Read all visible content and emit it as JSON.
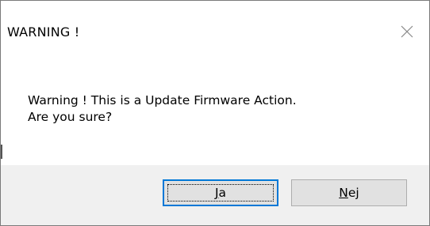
{
  "window": {
    "title": "WARNING !",
    "close_icon": "close-icon"
  },
  "message": {
    "line1": "Warning ! This is a Update Firmware Action.",
    "line2": "Are you sure?"
  },
  "buttons": {
    "yes": {
      "accel": "J",
      "rest": "a",
      "label": "Ja"
    },
    "no": {
      "accel": "N",
      "rest": "ej",
      "label": "Nej"
    }
  },
  "colors": {
    "footer_bg": "#f0f0f0",
    "button_bg": "#e1e1e1",
    "default_border": "#0078d7"
  }
}
